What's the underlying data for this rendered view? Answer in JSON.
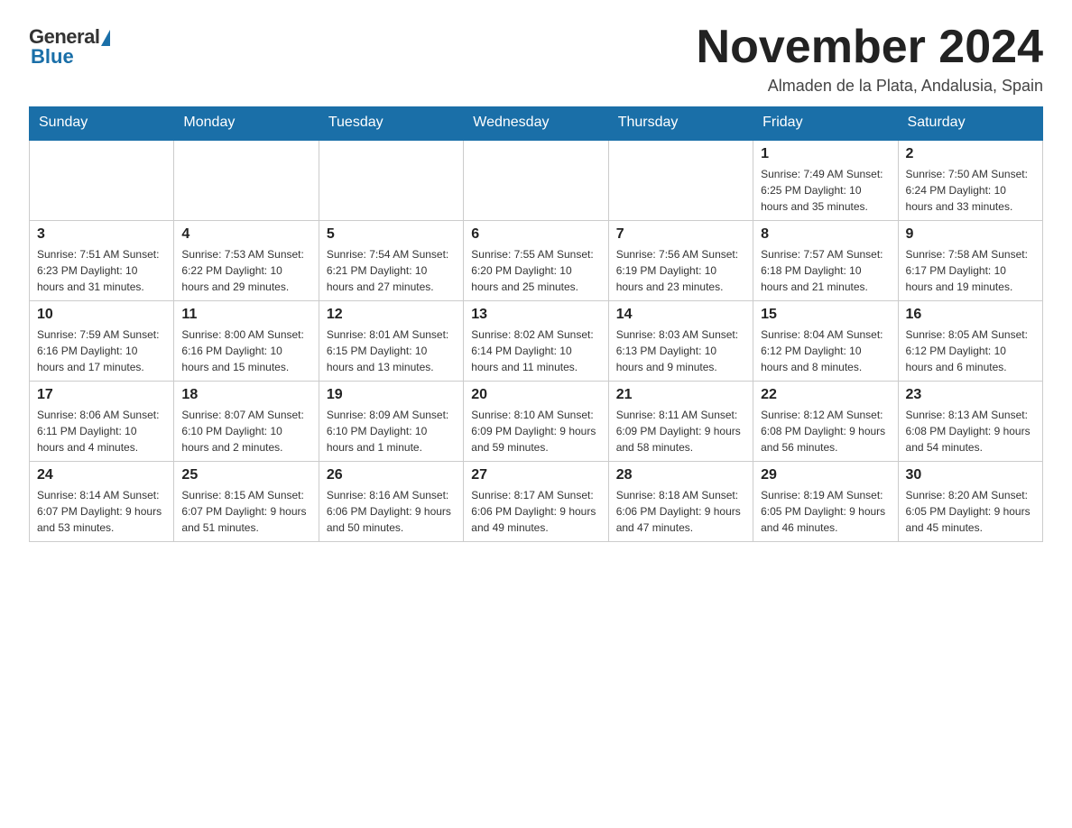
{
  "header": {
    "logo": {
      "general": "General",
      "blue": "Blue"
    },
    "title": "November 2024",
    "location": "Almaden de la Plata, Andalusia, Spain"
  },
  "weekdays": [
    "Sunday",
    "Monday",
    "Tuesday",
    "Wednesday",
    "Thursday",
    "Friday",
    "Saturday"
  ],
  "weeks": [
    [
      {
        "day": "",
        "info": ""
      },
      {
        "day": "",
        "info": ""
      },
      {
        "day": "",
        "info": ""
      },
      {
        "day": "",
        "info": ""
      },
      {
        "day": "",
        "info": ""
      },
      {
        "day": "1",
        "info": "Sunrise: 7:49 AM\nSunset: 6:25 PM\nDaylight: 10 hours and 35 minutes."
      },
      {
        "day": "2",
        "info": "Sunrise: 7:50 AM\nSunset: 6:24 PM\nDaylight: 10 hours and 33 minutes."
      }
    ],
    [
      {
        "day": "3",
        "info": "Sunrise: 7:51 AM\nSunset: 6:23 PM\nDaylight: 10 hours and 31 minutes."
      },
      {
        "day": "4",
        "info": "Sunrise: 7:53 AM\nSunset: 6:22 PM\nDaylight: 10 hours and 29 minutes."
      },
      {
        "day": "5",
        "info": "Sunrise: 7:54 AM\nSunset: 6:21 PM\nDaylight: 10 hours and 27 minutes."
      },
      {
        "day": "6",
        "info": "Sunrise: 7:55 AM\nSunset: 6:20 PM\nDaylight: 10 hours and 25 minutes."
      },
      {
        "day": "7",
        "info": "Sunrise: 7:56 AM\nSunset: 6:19 PM\nDaylight: 10 hours and 23 minutes."
      },
      {
        "day": "8",
        "info": "Sunrise: 7:57 AM\nSunset: 6:18 PM\nDaylight: 10 hours and 21 minutes."
      },
      {
        "day": "9",
        "info": "Sunrise: 7:58 AM\nSunset: 6:17 PM\nDaylight: 10 hours and 19 minutes."
      }
    ],
    [
      {
        "day": "10",
        "info": "Sunrise: 7:59 AM\nSunset: 6:16 PM\nDaylight: 10 hours and 17 minutes."
      },
      {
        "day": "11",
        "info": "Sunrise: 8:00 AM\nSunset: 6:16 PM\nDaylight: 10 hours and 15 minutes."
      },
      {
        "day": "12",
        "info": "Sunrise: 8:01 AM\nSunset: 6:15 PM\nDaylight: 10 hours and 13 minutes."
      },
      {
        "day": "13",
        "info": "Sunrise: 8:02 AM\nSunset: 6:14 PM\nDaylight: 10 hours and 11 minutes."
      },
      {
        "day": "14",
        "info": "Sunrise: 8:03 AM\nSunset: 6:13 PM\nDaylight: 10 hours and 9 minutes."
      },
      {
        "day": "15",
        "info": "Sunrise: 8:04 AM\nSunset: 6:12 PM\nDaylight: 10 hours and 8 minutes."
      },
      {
        "day": "16",
        "info": "Sunrise: 8:05 AM\nSunset: 6:12 PM\nDaylight: 10 hours and 6 minutes."
      }
    ],
    [
      {
        "day": "17",
        "info": "Sunrise: 8:06 AM\nSunset: 6:11 PM\nDaylight: 10 hours and 4 minutes."
      },
      {
        "day": "18",
        "info": "Sunrise: 8:07 AM\nSunset: 6:10 PM\nDaylight: 10 hours and 2 minutes."
      },
      {
        "day": "19",
        "info": "Sunrise: 8:09 AM\nSunset: 6:10 PM\nDaylight: 10 hours and 1 minute."
      },
      {
        "day": "20",
        "info": "Sunrise: 8:10 AM\nSunset: 6:09 PM\nDaylight: 9 hours and 59 minutes."
      },
      {
        "day": "21",
        "info": "Sunrise: 8:11 AM\nSunset: 6:09 PM\nDaylight: 9 hours and 58 minutes."
      },
      {
        "day": "22",
        "info": "Sunrise: 8:12 AM\nSunset: 6:08 PM\nDaylight: 9 hours and 56 minutes."
      },
      {
        "day": "23",
        "info": "Sunrise: 8:13 AM\nSunset: 6:08 PM\nDaylight: 9 hours and 54 minutes."
      }
    ],
    [
      {
        "day": "24",
        "info": "Sunrise: 8:14 AM\nSunset: 6:07 PM\nDaylight: 9 hours and 53 minutes."
      },
      {
        "day": "25",
        "info": "Sunrise: 8:15 AM\nSunset: 6:07 PM\nDaylight: 9 hours and 51 minutes."
      },
      {
        "day": "26",
        "info": "Sunrise: 8:16 AM\nSunset: 6:06 PM\nDaylight: 9 hours and 50 minutes."
      },
      {
        "day": "27",
        "info": "Sunrise: 8:17 AM\nSunset: 6:06 PM\nDaylight: 9 hours and 49 minutes."
      },
      {
        "day": "28",
        "info": "Sunrise: 8:18 AM\nSunset: 6:06 PM\nDaylight: 9 hours and 47 minutes."
      },
      {
        "day": "29",
        "info": "Sunrise: 8:19 AM\nSunset: 6:05 PM\nDaylight: 9 hours and 46 minutes."
      },
      {
        "day": "30",
        "info": "Sunrise: 8:20 AM\nSunset: 6:05 PM\nDaylight: 9 hours and 45 minutes."
      }
    ]
  ]
}
